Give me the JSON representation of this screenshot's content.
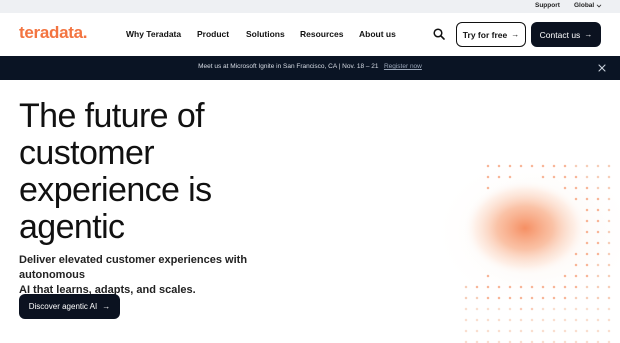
{
  "utility": {
    "support_label": "Support",
    "global_label": "Global"
  },
  "header": {
    "logo_text": "teradata.",
    "nav": [
      "Why Teradata",
      "Product",
      "Solutions",
      "Resources",
      "About us"
    ],
    "try_label": "Try for free",
    "contact_label": "Contact us"
  },
  "banner": {
    "text": "Meet us at Microsoft Ignite in San Francisco, CA | Nov. 18 – 21",
    "link_label": "Register now"
  },
  "hero": {
    "title_lines": [
      "The future of",
      "customer",
      "experience is",
      "agentic"
    ],
    "subtitle_lines": [
      "Deliver elevated customer experiences with autonomous",
      "AI that learns, adapts, and scales."
    ],
    "cta_label": "Discover agentic AI"
  },
  "colors": {
    "brand_orange": "#f37440",
    "dark_navy": "#0b1220",
    "banner_bg": "#0a1424",
    "utility_bg": "#eef0f3"
  },
  "icons": {
    "search": "search-icon",
    "chevron": "chevron-down-icon",
    "close": "close-icon",
    "arrow": "arrow-right-icon"
  }
}
